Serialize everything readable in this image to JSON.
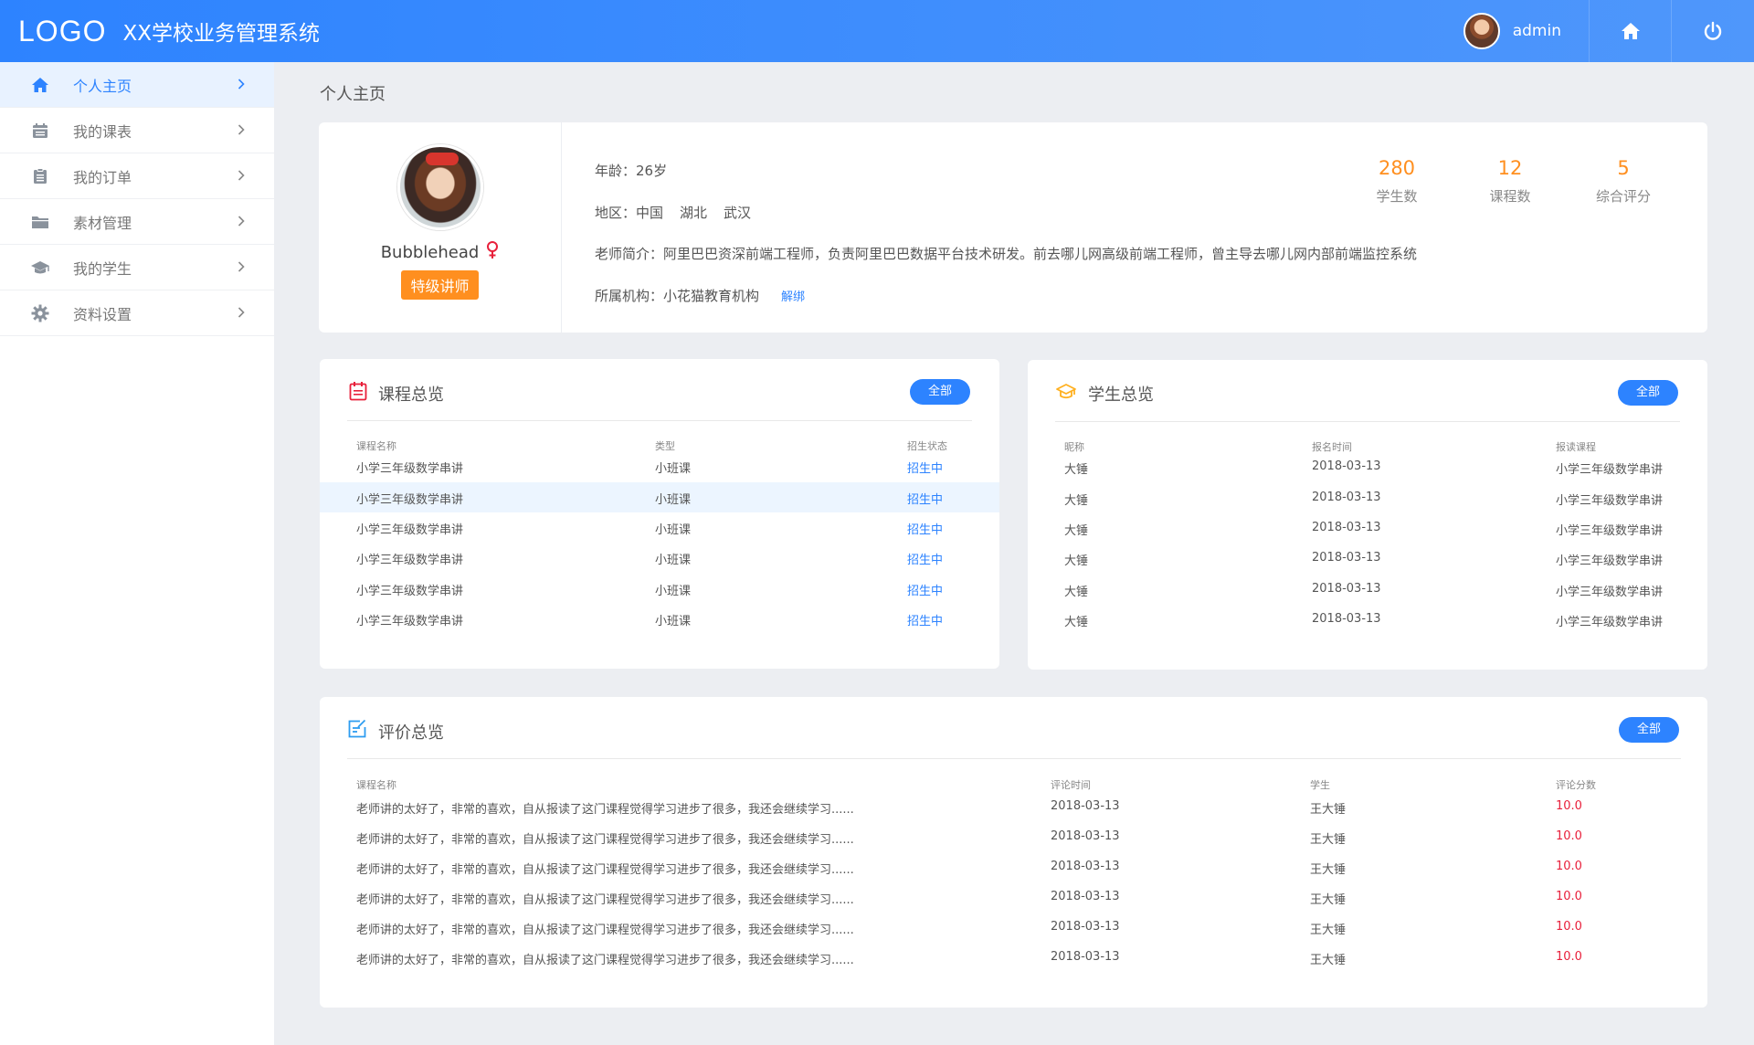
{
  "header": {
    "logo": "LOGO",
    "title": "XX学校业务管理系统",
    "user": "admin",
    "icons": {
      "home": "home-icon",
      "power": "power-icon"
    }
  },
  "sidebar": {
    "items": [
      {
        "label": "个人主页",
        "icon": "home-icon",
        "active": true
      },
      {
        "label": "我的课表",
        "icon": "calendar-icon",
        "active": false
      },
      {
        "label": "我的订单",
        "icon": "clipboard-icon",
        "active": false
      },
      {
        "label": "素材管理",
        "icon": "folder-icon",
        "active": false
      },
      {
        "label": "我的学生",
        "icon": "graduation-cap-icon",
        "active": false
      },
      {
        "label": "资料设置",
        "icon": "gear-icon",
        "active": false
      }
    ]
  },
  "breadcrumb": "个人主页",
  "profile": {
    "name": "Bubblehead",
    "tag": "特级讲师",
    "age_label": "年龄：",
    "age": "26岁",
    "region_label": "地区：",
    "region": [
      "中国",
      "湖北",
      "武汉"
    ],
    "intro_label": "老师简介：",
    "intro": "阿里巴巴资深前端工程师，负责阿里巴巴数据平台技术研发。前去哪儿网高级前端工程师，曾主导去哪儿网内部前端监控系统",
    "org_label": "所属机构：",
    "org": "小花猫教育机构",
    "unbind": "解绑",
    "stats": [
      {
        "value": "280",
        "label": "学生数"
      },
      {
        "value": "12",
        "label": "课程数"
      },
      {
        "value": "5",
        "label": "综合评分"
      }
    ]
  },
  "courses": {
    "title": "课程总览",
    "all": "全部",
    "columns": [
      "课程名称",
      "类型",
      "招生状态"
    ],
    "rows": [
      [
        "小学三年级数学串讲",
        "小班课",
        "招生中"
      ],
      [
        "小学三年级数学串讲",
        "小班课",
        "招生中"
      ],
      [
        "小学三年级数学串讲",
        "小班课",
        "招生中"
      ],
      [
        "小学三年级数学串讲",
        "小班课",
        "招生中"
      ],
      [
        "小学三年级数学串讲",
        "小班课",
        "招生中"
      ],
      [
        "小学三年级数学串讲",
        "小班课",
        "招生中"
      ]
    ]
  },
  "students": {
    "title": "学生总览",
    "all": "全部",
    "columns": [
      "昵称",
      "报名时间",
      "报读课程"
    ],
    "rows": [
      [
        "大锤",
        "2018-03-13",
        "小学三年级数学串讲"
      ],
      [
        "大锤",
        "2018-03-13",
        "小学三年级数学串讲"
      ],
      [
        "大锤",
        "2018-03-13",
        "小学三年级数学串讲"
      ],
      [
        "大锤",
        "2018-03-13",
        "小学三年级数学串讲"
      ],
      [
        "大锤",
        "2018-03-13",
        "小学三年级数学串讲"
      ],
      [
        "大锤",
        "2018-03-13",
        "小学三年级数学串讲"
      ]
    ]
  },
  "reviews": {
    "title": "评价总览",
    "all": "全部",
    "columns": [
      "课程名称",
      "评论时间",
      "学生",
      "评论分数"
    ],
    "rows": [
      [
        "老师讲的太好了，非常的喜欢，自从报读了这门课程觉得学习进步了很多，我还会继续学习......",
        "2018-03-13",
        "王大锤",
        "10.0"
      ],
      [
        "老师讲的太好了，非常的喜欢，自从报读了这门课程觉得学习进步了很多，我还会继续学习......",
        "2018-03-13",
        "王大锤",
        "10.0"
      ],
      [
        "老师讲的太好了，非常的喜欢，自从报读了这门课程觉得学习进步了很多，我还会继续学习......",
        "2018-03-13",
        "王大锤",
        "10.0"
      ],
      [
        "老师讲的太好了，非常的喜欢，自从报读了这门课程觉得学习进步了很多，我还会继续学习......",
        "2018-03-13",
        "王大锤",
        "10.0"
      ],
      [
        "老师讲的太好了，非常的喜欢，自从报读了这门课程觉得学习进步了很多，我还会继续学习......",
        "2018-03-13",
        "王大锤",
        "10.0"
      ],
      [
        "老师讲的太好了，非常的喜欢，自从报读了这门课程觉得学习进步了很多，我还会继续学习......",
        "2018-03-13",
        "王大锤",
        "10.0"
      ]
    ]
  },
  "colors": {
    "primary": "#2d83ff",
    "accent": "#ff8f1f",
    "score": "#e8203b"
  }
}
